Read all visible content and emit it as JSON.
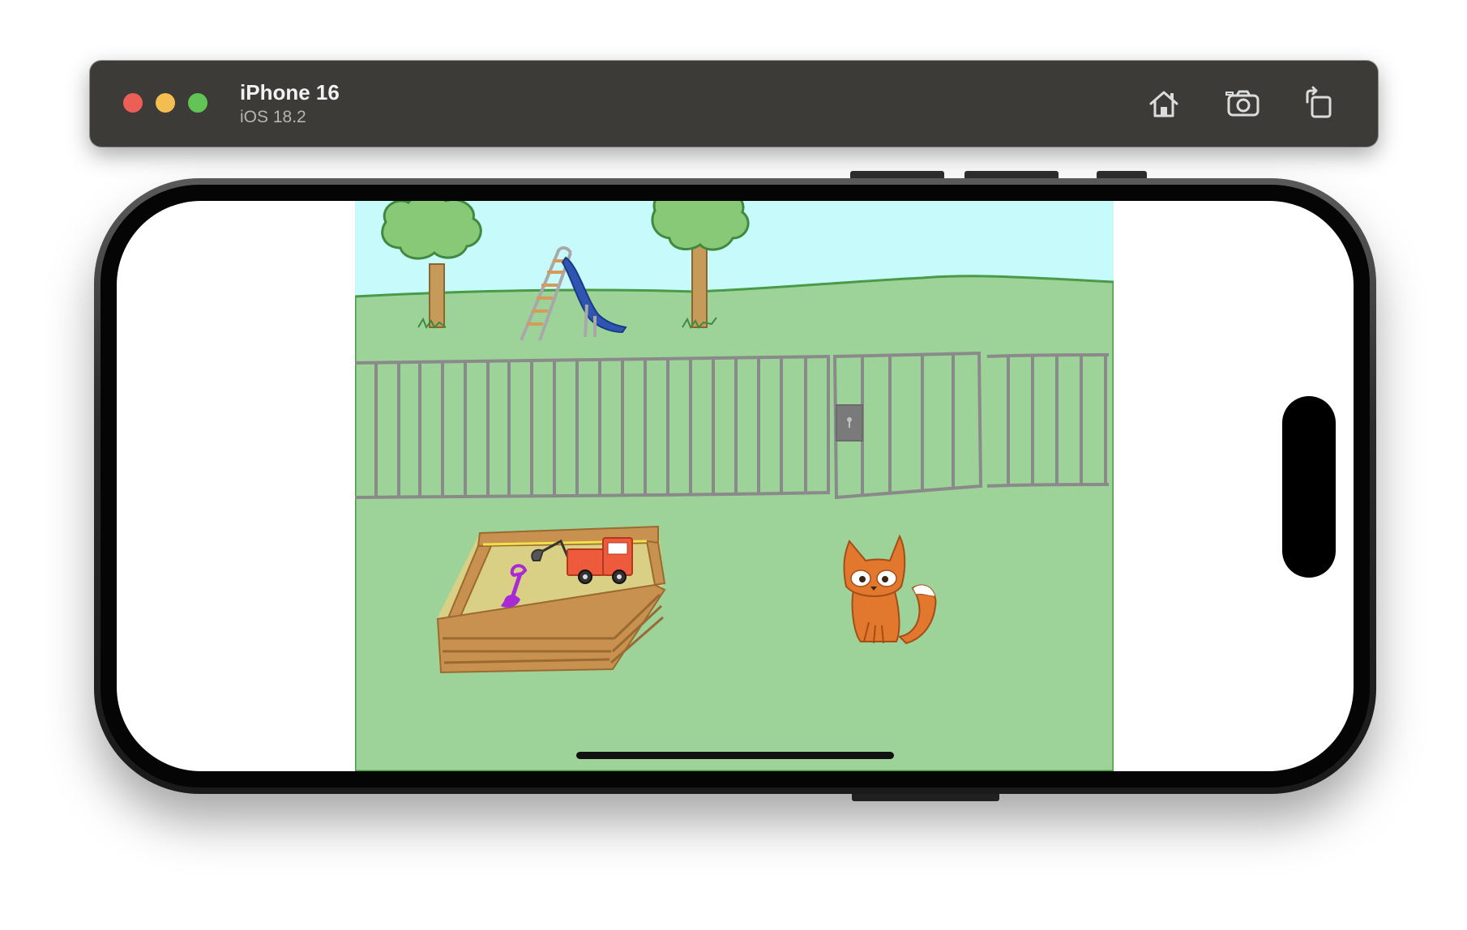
{
  "simulator": {
    "device_name": "iPhone 16",
    "os_version": "iOS 18.2"
  },
  "toolbar": {
    "home_icon": "home-icon",
    "screenshot_icon": "camera-icon",
    "rotate_icon": "rotate-icon"
  },
  "colors": {
    "titlebar": "#3c3b38",
    "close": "#ec5f57",
    "minimize": "#f4bd4f",
    "maximize": "#61c454",
    "sky": "#c7fbfb",
    "grass": "#9dd399",
    "fence": "#8a8a8a",
    "sand": "#d9cf85",
    "box_wood": "#c8914f",
    "fox": "#e2772e",
    "truck": "#ee5a3c",
    "shovel": "#a72ad6",
    "slide": "#2f55b3"
  },
  "scene": {
    "objects": [
      "tree",
      "tree",
      "slide",
      "fence",
      "gate",
      "sandbox",
      "shovel",
      "toy-truck",
      "fox"
    ]
  }
}
